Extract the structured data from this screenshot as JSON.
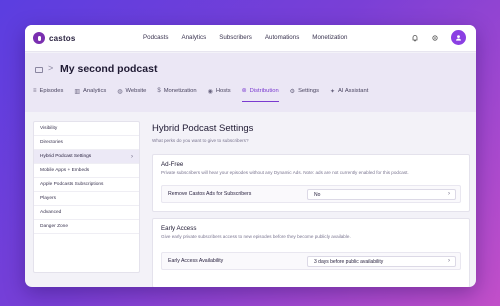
{
  "app": {
    "logo_text": "castos"
  },
  "topnav": {
    "links": [
      "Podcasts",
      "Analytics",
      "Subscribers",
      "Automations",
      "Monetization"
    ],
    "avatar_icon": "user-icon"
  },
  "header": {
    "breadcrumb_icon": "folder-icon",
    "separator": ">",
    "podcast_title": "My second podcast",
    "tabs": [
      {
        "label": "Episodes",
        "icon": "list-icon"
      },
      {
        "label": "Analytics",
        "icon": "chart-icon"
      },
      {
        "label": "Website",
        "icon": "globe-icon"
      },
      {
        "label": "Monetization",
        "icon": "dollar-icon"
      },
      {
        "label": "Hosts",
        "icon": "mic-icon"
      },
      {
        "label": "Distribution",
        "icon": "broadcast-icon",
        "active": true
      },
      {
        "label": "Settings",
        "icon": "gear-icon"
      },
      {
        "label": "AI Assistant",
        "icon": "sparkle-icon"
      }
    ]
  },
  "sidebar": {
    "items": [
      {
        "label": "Visibility"
      },
      {
        "label": "Directories"
      },
      {
        "label": "Hybrid Podcast Settings",
        "active": true
      },
      {
        "label": "Mobile Apps + Embeds"
      },
      {
        "label": "Apple Podcasts Subscriptions"
      },
      {
        "label": "Players"
      },
      {
        "label": "Advanced"
      },
      {
        "label": "Danger Zone"
      }
    ]
  },
  "main": {
    "title": "Hybrid Podcast Settings",
    "subtitle": "What perks do you want to give to subscribers?",
    "ad_free": {
      "title": "Ad-Free",
      "description": "Private subscribers will hear your episodes without any Dynamic Ads. Note: ads are not currently enabled for this podcast.",
      "field_label": "Remove Castos Ads for Subscribers",
      "field_value": "No"
    },
    "early_access": {
      "title": "Early Access",
      "description": "Give early private subscribers access to new episodes before they become publicly available.",
      "field_label": "Early Access Availability",
      "field_value": "3 days before public availability"
    }
  },
  "colors": {
    "accent": "#7a3ad0",
    "brand": "#7a2fb0"
  }
}
